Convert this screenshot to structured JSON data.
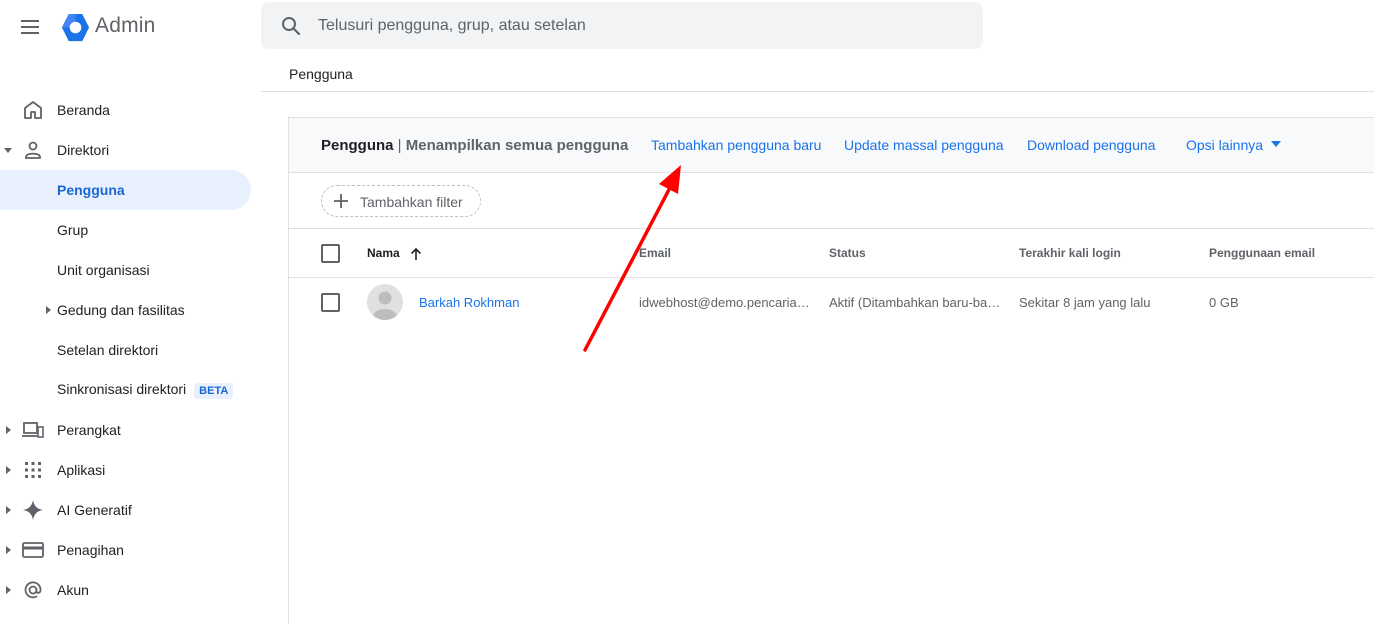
{
  "header": {
    "brand": "Admin",
    "search_placeholder": "Telusuri pengguna, grup, atau setelan"
  },
  "breadcrumb": "Pengguna",
  "sidebar": {
    "items": [
      {
        "label": "Beranda",
        "icon": "home-icon"
      },
      {
        "label": "Direktori",
        "icon": "person-icon",
        "expanded": true
      },
      {
        "label": "Pengguna",
        "active": true
      },
      {
        "label": "Grup"
      },
      {
        "label": "Unit organisasi"
      },
      {
        "label": "Gedung dan fasilitas",
        "has_children": true
      },
      {
        "label": "Setelan direktori"
      },
      {
        "label": "Sinkronisasi direktori",
        "badge": "BETA"
      },
      {
        "label": "Perangkat",
        "icon": "devices-icon"
      },
      {
        "label": "Aplikasi",
        "icon": "apps-grid-icon"
      },
      {
        "label": "AI Generatif",
        "icon": "sparkle-icon"
      },
      {
        "label": "Penagihan",
        "icon": "credit-card-icon"
      },
      {
        "label": "Akun",
        "icon": "at-sign-icon"
      }
    ]
  },
  "card": {
    "title": "Pengguna",
    "separator": " | ",
    "subtitle": "Menampilkan semua pengguna",
    "actions": {
      "add_user": "Tambahkan pengguna baru",
      "bulk_update": "Update massal pengguna",
      "download": "Download pengguna",
      "more": "Opsi lainnya"
    }
  },
  "filter": {
    "add_label": "Tambahkan filter"
  },
  "table": {
    "columns": {
      "name": "Nama",
      "email": "Email",
      "status": "Status",
      "last_login": "Terakhir kali login",
      "email_usage": "Penggunaan email"
    },
    "rows": [
      {
        "name": "Barkah Rokhman",
        "email": "idwebhost@demo.pencaria…",
        "status": "Aktif (Ditambahkan baru-ba…",
        "last_login": "Sekitar 8 jam yang lalu",
        "email_usage": "0 GB"
      }
    ]
  },
  "colors": {
    "accent": "#1a73e8",
    "active_bg": "#e8f0fe",
    "annotation": "#ff0000"
  }
}
